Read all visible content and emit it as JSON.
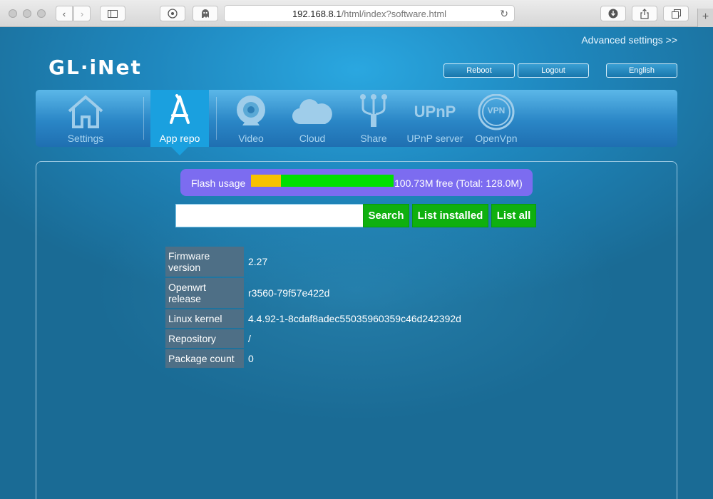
{
  "browser": {
    "url_host": "192.168.8.1",
    "url_path": "/html/index?software.html"
  },
  "header": {
    "advanced_settings": "Advanced settings >>",
    "logo_text": "GL·iNet",
    "reboot": "Reboot",
    "logout": "Logout",
    "language": "English"
  },
  "nav": {
    "items": [
      {
        "label": "Settings",
        "icon": "home-icon"
      },
      {
        "label": "App repo",
        "icon": "app-store-icon",
        "active": true
      },
      {
        "label": "Video",
        "icon": "webcam-icon"
      },
      {
        "label": "Cloud",
        "icon": "cloud-icon"
      },
      {
        "label": "Share",
        "icon": "usb-icon"
      },
      {
        "label": "UPnP server",
        "icon": "upnp-icon"
      },
      {
        "label": "OpenVpn",
        "icon": "vpn-icon"
      }
    ],
    "upnp_icon_text": "UPnP",
    "vpn_icon_text": "VPN"
  },
  "flash": {
    "label": "Flash usage",
    "used_fraction": 0.21,
    "free_text": "100.73M free (Total: 128.0M)"
  },
  "search": {
    "value": "",
    "search_label": "Search",
    "list_installed_label": "List installed",
    "list_all_label": "List all"
  },
  "info": {
    "rows": [
      {
        "key": "Firmware version",
        "value": "2.27"
      },
      {
        "key": "Openwrt release",
        "value": "r3560-79f57e422d"
      },
      {
        "key": "Linux kernel",
        "value": "4.4.92-1-8cdaf8adec55035960359c46d242392d"
      },
      {
        "key": "Repository",
        "value": "/"
      },
      {
        "key": "Package count",
        "value": "0"
      }
    ]
  },
  "colors": {
    "flash_bg": "#7c6cf0",
    "flash_used": "#f7c200",
    "flash_free": "#00e000",
    "action_button": "#0fb00f",
    "active_tab": "#1aa0df"
  }
}
